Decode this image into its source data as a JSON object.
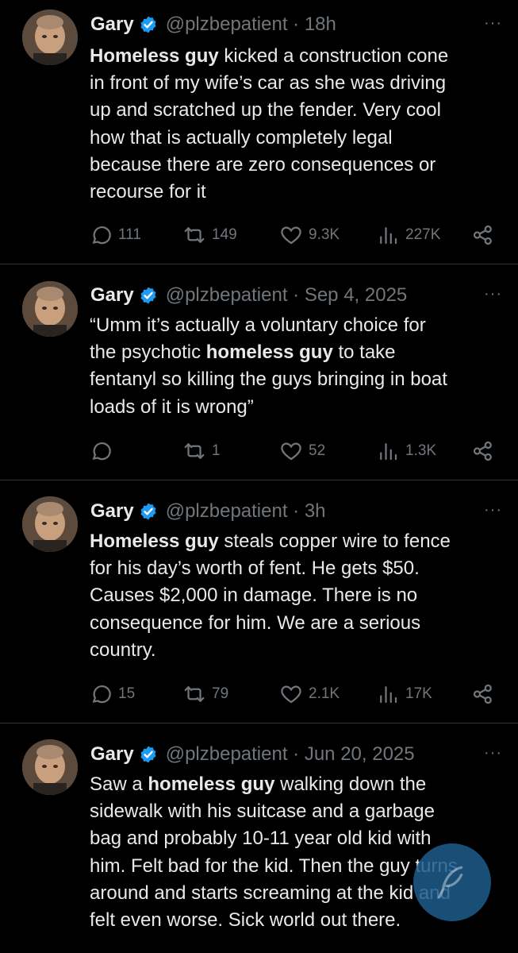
{
  "colors": {
    "background": "#000000",
    "text": "#e7e9ea",
    "muted": "#71767b",
    "verified": "#1d9bf0",
    "divider": "#2f3336"
  },
  "tweets": [
    {
      "name": "Gary",
      "handle_time": "@plzbepatient · 18h",
      "more": "···",
      "lines": [
        {
          "bold": "Homeless guy",
          "rest": " kicked a construction cone"
        },
        {
          "bold": "",
          "rest": "in front of my wife’s car as she was driving"
        },
        {
          "bold": "",
          "rest": "up and scratched up the fender. Very cool"
        },
        {
          "bold": "",
          "rest": "how that is actually completely legal"
        },
        {
          "bold": "",
          "rest": "because there are zero consequences or"
        },
        {
          "bold": "",
          "rest": "recourse for it"
        }
      ],
      "replies": "111",
      "retweets": "149",
      "likes": "9.3K",
      "views": "227K"
    },
    {
      "name": "Gary",
      "handle_time": "@plzbepatient · Sep 4, 2025",
      "more": "···",
      "lines": [
        {
          "pre": "",
          "bold": "",
          "rest": "“Umm it’s actually a voluntary choice for"
        },
        {
          "pre": "the psychotic ",
          "bold": "homeless guy",
          "rest": " to take"
        },
        {
          "pre": "",
          "bold": "",
          "rest": "fentanyl so killing the guys bringing in boat"
        },
        {
          "pre": "",
          "bold": "",
          "rest": "loads of it is wrong”"
        }
      ],
      "replies": "",
      "retweets": "1",
      "likes": "52",
      "views": "1.3K"
    },
    {
      "name": "Gary",
      "handle_time": "@plzbepatient · 3h",
      "more": "···",
      "lines": [
        {
          "bold": "Homeless guy",
          "rest": " steals copper wire to fence"
        },
        {
          "bold": "",
          "rest": "for his day’s worth of fent. He gets $50."
        },
        {
          "bold": "",
          "rest": "Causes $2,000 in damage. There is no"
        },
        {
          "bold": "",
          "rest": "consequence for him. We are a serious"
        },
        {
          "bold": "",
          "rest": "country."
        }
      ],
      "replies": "15",
      "retweets": "79",
      "likes": "2.1K",
      "views": "17K"
    },
    {
      "name": "Gary",
      "handle_time": "@plzbepatient · Jun 20, 2025",
      "more": "···",
      "lines": [
        {
          "pre": "Saw a ",
          "bold": "homeless guy",
          "rest": " walking down the"
        },
        {
          "pre": "",
          "bold": "",
          "rest": "sidewalk with his suitcase and a garbage"
        },
        {
          "pre": "",
          "bold": "",
          "rest": "bag and probably 10-11 year old kid with"
        },
        {
          "pre": "",
          "bold": "",
          "rest": "him. Felt bad for the kid. Then the guy turns"
        },
        {
          "pre": "",
          "bold": "",
          "rest": "around and starts screaming at the kid and"
        },
        {
          "pre": "",
          "bold": "",
          "rest": "felt even worse. Sick world out there."
        }
      ]
    }
  ],
  "watermark": {
    "icon": "quill-watermark-icon"
  }
}
